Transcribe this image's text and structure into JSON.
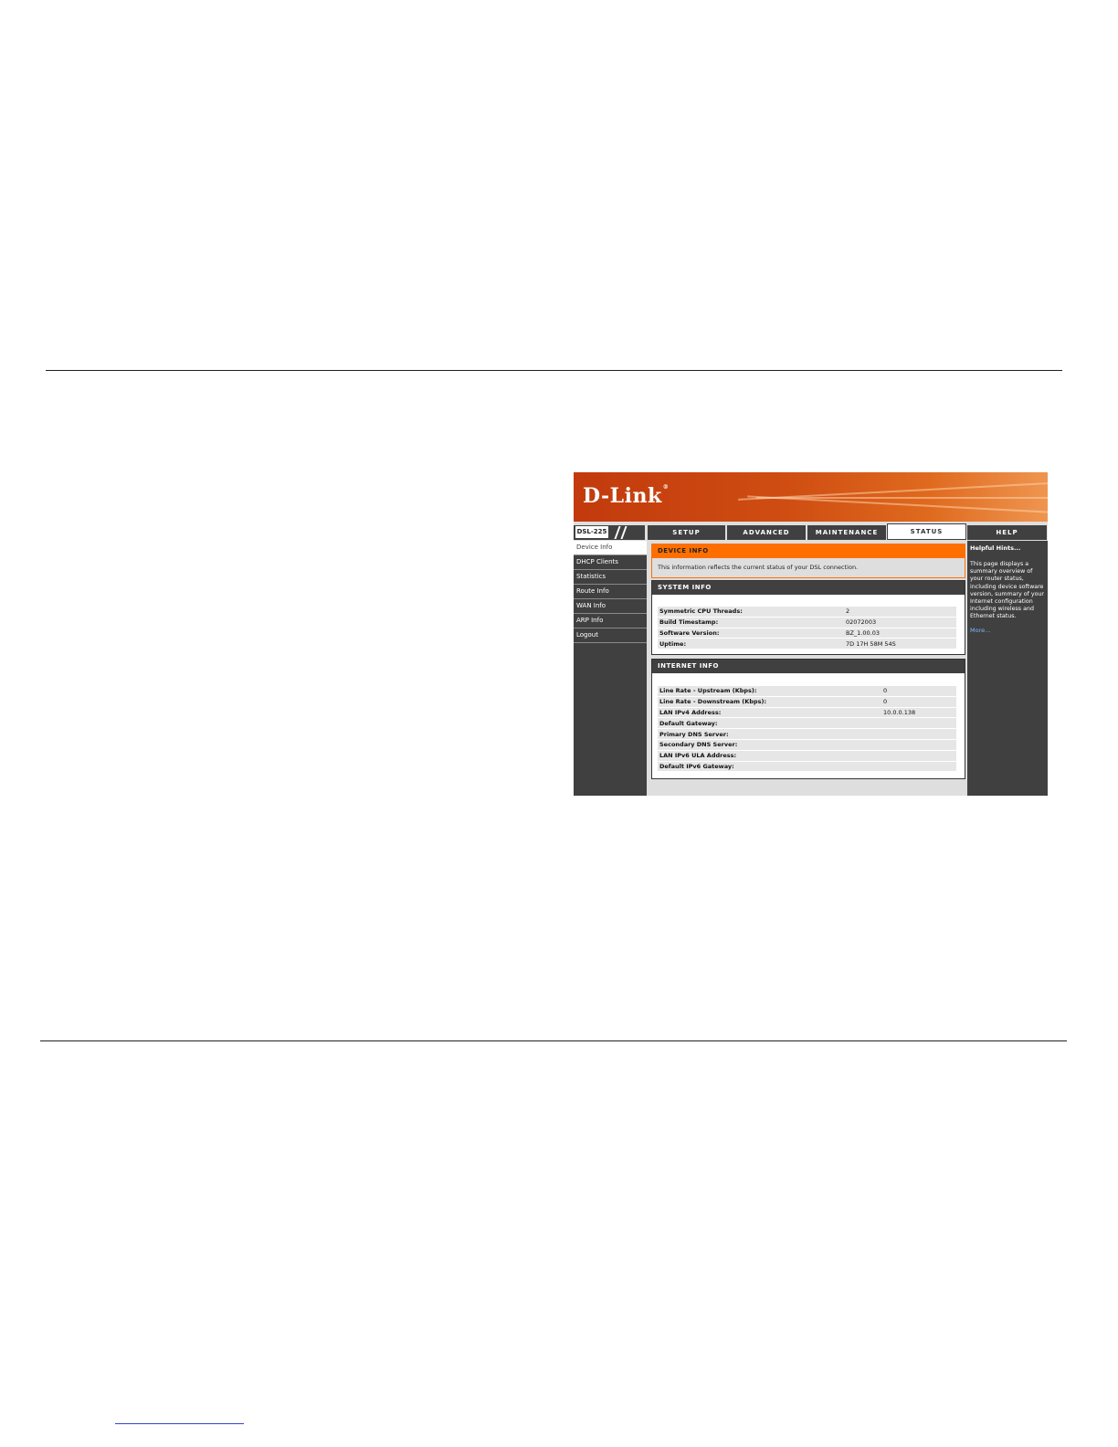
{
  "brand": {
    "logo_text": "D-Link",
    "logo_mark": "®"
  },
  "model": "DSL-225",
  "tabs": [
    {
      "label": "SETUP",
      "active": false
    },
    {
      "label": "ADVANCED",
      "active": false
    },
    {
      "label": "MAINTENANCE",
      "active": false
    },
    {
      "label": "STATUS",
      "active": true
    }
  ],
  "help_tab": "HELP",
  "sidebar": {
    "items": [
      {
        "label": "Device Info",
        "active": true
      },
      {
        "label": "DHCP Clients"
      },
      {
        "label": "Statistics"
      },
      {
        "label": "Route Info"
      },
      {
        "label": "WAN Info"
      },
      {
        "label": "ARP Info"
      },
      {
        "label": "Logout"
      }
    ]
  },
  "device_info": {
    "title": "DEVICE INFO",
    "text": "This information reflects the current status of your DSL connection."
  },
  "system_info": {
    "title": "SYSTEM INFO",
    "rows": [
      {
        "label": "Symmetric CPU Threads:",
        "value": "2"
      },
      {
        "label": "Build Timestamp:",
        "value": "02072003"
      },
      {
        "label": "Software Version:",
        "value": "BZ_1.00.03"
      },
      {
        "label": "Uptime:",
        "value": "7D 17H 58M 54S"
      }
    ]
  },
  "internet_info": {
    "title": "INTERNET INFO",
    "rows": [
      {
        "label": "Line Rate - Upstream (Kbps):",
        "value": "0"
      },
      {
        "label": "Line Rate - Downstream (Kbps):",
        "value": "0"
      },
      {
        "label": "LAN IPv4 Address:",
        "value": "10.0.0.138"
      },
      {
        "label": "Default Gateway:",
        "value": ""
      },
      {
        "label": "Primary DNS Server:",
        "value": ""
      },
      {
        "label": "Secondary DNS Server:",
        "value": ""
      },
      {
        "label": "LAN IPv6 ULA Address:",
        "value": ""
      },
      {
        "label": "Default IPv6 Gateway:",
        "value": ""
      }
    ]
  },
  "help": {
    "title": "Helpful Hints...",
    "text": "This page displays a summary overview of your router status, including device software version, summary of your Internet configuration including wireless and Ethernet status.",
    "more": "More..."
  },
  "colors": {
    "accent": "#ff6f00",
    "banner": "#cf4d12",
    "dark_panel": "#404040",
    "link": "#7fb2ff"
  }
}
